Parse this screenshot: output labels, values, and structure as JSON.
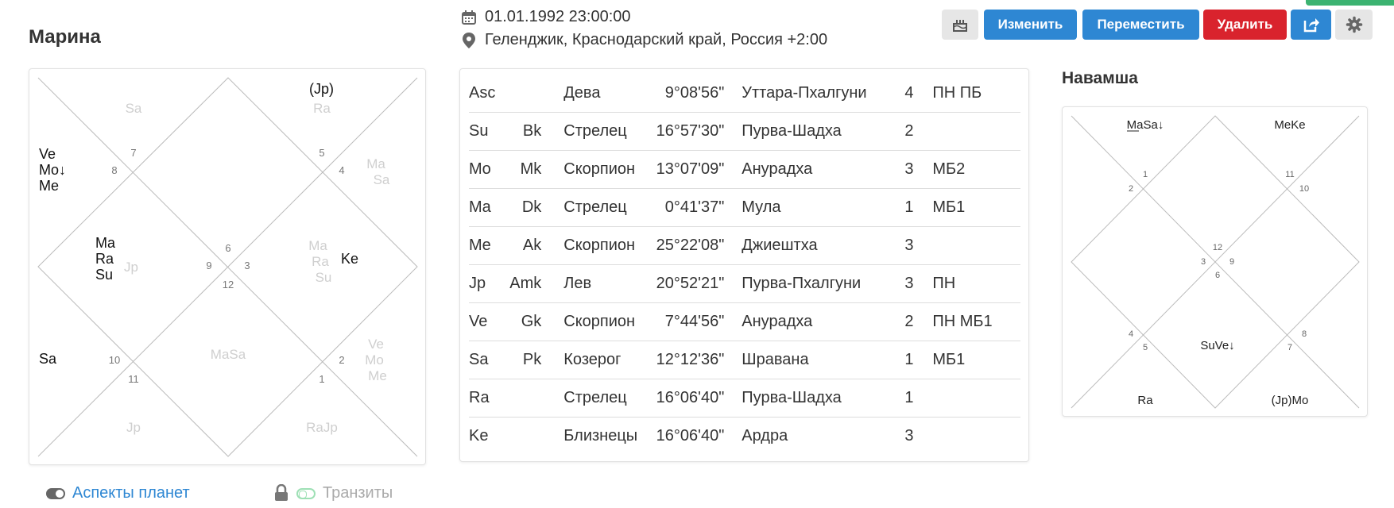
{
  "person": {
    "name": "Марина"
  },
  "datetime": "01.01.1992 23:00:00",
  "location": "Геленджик, Краснодарский край, Россия +2:00",
  "buttons": {
    "edit": "Изменить",
    "move": "Переместить",
    "delete": "Удалить"
  },
  "icons": {
    "cake": "cake-icon",
    "share": "share-icon",
    "settings": "gear-icon",
    "calendar": "calendar-icon",
    "pin": "map-pin-icon",
    "lock": "lock-icon"
  },
  "colors": {
    "primary": "#2e87d3",
    "danger": "#d9232d",
    "success": "#3cb371",
    "line": "#bbbbbb"
  },
  "rasi_chart": {
    "house_numbers": [
      "7",
      "8",
      "5",
      "4",
      "6",
      "9",
      "3",
      "12",
      "10",
      "11",
      "2",
      "1"
    ],
    "black_labels": [
      "Ve",
      "Mo↓",
      "Me",
      "(Jp)",
      "Ma",
      "Ra",
      "Su",
      "Ke",
      "Sa"
    ],
    "grey_labels": [
      "Sa",
      "Ra",
      "Ma",
      "Sa",
      "Jp",
      "Ma",
      "Ra",
      "Su",
      "MaSa",
      "Ve",
      "Mo",
      "Me",
      "Jp",
      "RaJp"
    ]
  },
  "table": {
    "rows": [
      [
        "Asc",
        "",
        "Дева",
        "9°08'56\"",
        "Уттара-Пхалгуни",
        "4",
        "ПН ПБ"
      ],
      [
        "Su",
        "Bk",
        "Стрелец",
        "16°57'30\"",
        "Пурва-Шадха",
        "2",
        ""
      ],
      [
        "Mo",
        "Mk",
        "Скорпион",
        "13°07'09\"",
        "Анурадха",
        "3",
        "МБ2"
      ],
      [
        "Ma",
        "Dk",
        "Стрелец",
        "0°41'37\"",
        "Мула",
        "1",
        "МБ1"
      ],
      [
        "Me",
        "Ak",
        "Скорпион",
        "25°22'08\"",
        "Джиештха",
        "3",
        ""
      ],
      [
        "Jp",
        "Amk",
        "Лев",
        "20°52'21\"",
        "Пурва-Пхалгуни",
        "3",
        "ПН"
      ],
      [
        "Ve",
        "Gk",
        "Скорпион",
        "7°44'56\"",
        "Анурадха",
        "2",
        "ПН МБ1"
      ],
      [
        "Sa",
        "Pk",
        "Козерог",
        "12°12'36\"",
        "Шравана",
        "1",
        "МБ1"
      ],
      [
        "Ra",
        "",
        "Стрелец",
        "16°06'40\"",
        "Пурва-Шадха",
        "1",
        ""
      ],
      [
        "Ke",
        "",
        "Близнецы",
        "16°06'40\"",
        "Ардра",
        "3",
        ""
      ]
    ]
  },
  "navamsha": {
    "title": "Навамша",
    "house_numbers": [
      "1",
      "2",
      "11",
      "10",
      "12",
      "3",
      "9",
      "6",
      "4",
      "5",
      "8",
      "7"
    ],
    "labels": [
      "MaSa↓",
      "MeKe",
      "SuVe↓",
      "Ra",
      "(Jp)Mo"
    ]
  },
  "footer": {
    "aspects": "Аспекты планет",
    "transits": "Транзиты"
  }
}
